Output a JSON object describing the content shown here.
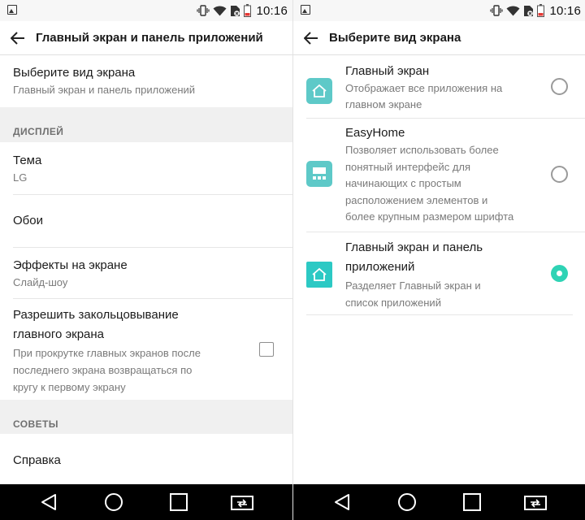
{
  "status": {
    "time": "10:16"
  },
  "left_pane": {
    "title": "Главный экран и панель приложений",
    "screen_type": {
      "title": "Выберите вид экрана",
      "value": "Главный экран и панель приложений"
    },
    "section_display": "ДИСПЛЕЙ",
    "theme": {
      "title": "Тема",
      "value": "LG"
    },
    "wallpaper": {
      "title": "Обои"
    },
    "effects": {
      "title": "Эффекты на экране",
      "value": "Слайд-шоу"
    },
    "loop": {
      "title_line1": "Разрешить закольцовывание",
      "title_line2": "главного экрана",
      "desc_line1": "При прокрутке главных экранов после",
      "desc_line2": "последнего экрана возвращаться по",
      "desc_line3": "кругу к первому экрану",
      "checked": false
    },
    "section_tips": "СОВЕТЫ",
    "help": {
      "title": "Справка"
    }
  },
  "right_pane": {
    "title": "Выберите вид экрана",
    "options": [
      {
        "title_lines": [
          "Главный экран"
        ],
        "desc_lines": [
          "Отображает все приложения на",
          "главном экране"
        ],
        "icon": "home-icon",
        "selected": false
      },
      {
        "title_lines": [
          "EasyHome"
        ],
        "desc_lines": [
          "Позволяет использовать более",
          "понятный интерфейс для",
          "начинающих с простым",
          "расположением элементов и",
          "более крупным размером шрифта"
        ],
        "icon": "easyhome-icon",
        "selected": false
      },
      {
        "title_lines": [
          "Главный экран и панель",
          "приложений"
        ],
        "desc_lines": [
          "Разделяет Главный экран и",
          "список приложений"
        ],
        "icon": "home-drawer-icon",
        "selected": true
      }
    ]
  },
  "colors": {
    "accent": "#2fd3b5",
    "icon_teal": "#5ec9c8",
    "nav_bg": "#000000",
    "section_bg": "#f0f0f0"
  }
}
